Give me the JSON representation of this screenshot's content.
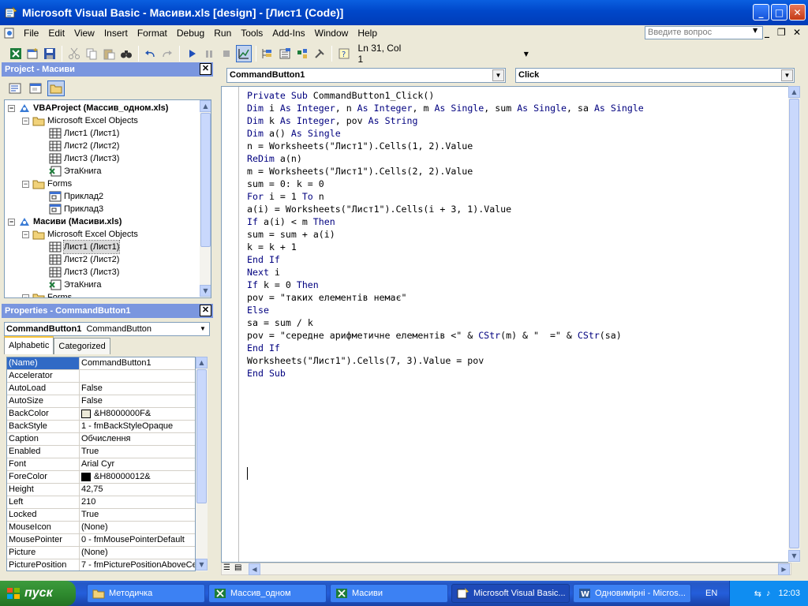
{
  "window": {
    "title": "Microsoft Visual Basic - Масиви.xls [design] - [Лист1 (Code)]",
    "minimize": "_",
    "maximize": "□",
    "close": "✕"
  },
  "menu": [
    "File",
    "Edit",
    "View",
    "Insert",
    "Format",
    "Debug",
    "Run",
    "Tools",
    "Add-Ins",
    "Window",
    "Help"
  ],
  "help_box": {
    "placeholder": "Введите вопрос"
  },
  "toolbar": {
    "position": "Ln 31, Col 1"
  },
  "project": {
    "title": "Project - Масиви",
    "nodes": [
      {
        "label": "VBAProject (Массив_одном.xls)",
        "bold": true
      },
      {
        "label": "Microsoft Excel Objects"
      },
      {
        "label": "Лист1 (Лист1)"
      },
      {
        "label": "Лист2 (Лист2)"
      },
      {
        "label": "Лист3 (Лист3)"
      },
      {
        "label": "ЭтаКнига"
      },
      {
        "label": "Forms"
      },
      {
        "label": "Приклад2"
      },
      {
        "label": "Приклад3"
      },
      {
        "label": "Масиви (Масиви.xls)",
        "bold": true
      },
      {
        "label": "Microsoft Excel Objects"
      },
      {
        "label": "Лист1 (Лист1)"
      },
      {
        "label": "Лист2 (Лист2)"
      },
      {
        "label": "Лист3 (Лист3)"
      },
      {
        "label": "ЭтаКнига"
      },
      {
        "label": "Forms"
      }
    ]
  },
  "properties": {
    "title": "Properties - CommandButton1",
    "object": "CommandButton1",
    "object_type": "CommandButton",
    "tabs": [
      "Alphabetic",
      "Categorized"
    ],
    "rows": [
      {
        "name": "(Name)",
        "value": "CommandButton1"
      },
      {
        "name": "Accelerator",
        "value": ""
      },
      {
        "name": "AutoLoad",
        "value": "False"
      },
      {
        "name": "AutoSize",
        "value": "False"
      },
      {
        "name": "BackColor",
        "value": "&H8000000F&",
        "swatch": "#ece9d8"
      },
      {
        "name": "BackStyle",
        "value": "1 - fmBackStyleOpaque"
      },
      {
        "name": "Caption",
        "value": "Обчислення"
      },
      {
        "name": "Enabled",
        "value": "True"
      },
      {
        "name": "Font",
        "value": "Arial Cyr"
      },
      {
        "name": "ForeColor",
        "value": "&H80000012&",
        "swatch": "#000000"
      },
      {
        "name": "Height",
        "value": "42,75"
      },
      {
        "name": "Left",
        "value": "210"
      },
      {
        "name": "Locked",
        "value": "True"
      },
      {
        "name": "MouseIcon",
        "value": "(None)"
      },
      {
        "name": "MousePointer",
        "value": "0 - fmMousePointerDefault"
      },
      {
        "name": "Picture",
        "value": "(None)"
      },
      {
        "name": "PicturePosition",
        "value": "7 - fmPicturePositionAboveCenter"
      }
    ]
  },
  "code": {
    "object_combo": "CommandButton1",
    "proc_combo": "Click",
    "lines": [
      "Private Sub CommandButton1_Click()",
      "Dim i As Integer, n As Integer, m As Single, sum As Single, sa As Single",
      "Dim k As Integer, pov As String",
      "Dim a() As Single",
      "n = Worksheets(\"Лист1\").Cells(1, 2).Value",
      "ReDim a(n)",
      "m = Worksheets(\"Лист1\").Cells(2, 2).Value",
      "sum = 0: k = 0",
      "For i = 1 To n",
      "a(i) = Worksheets(\"Лист1\").Cells(i + 3, 1).Value",
      "If a(i) < m Then",
      "sum = sum + a(i)",
      "k = k + 1",
      "End If",
      "Next i",
      "If k = 0 Then",
      "pov = \"таких елементів немає\"",
      "Else",
      "sa = sum / k",
      "pov = \"середне арифметичне елементів <\" & CStr(m) & \"  =\" & CStr(sa)",
      "End If",
      "Worksheets(\"Лист1\").Cells(7, 3).Value = pov",
      "End Sub"
    ]
  },
  "taskbar": {
    "start": "пуск",
    "tasks": [
      {
        "label": "Методичка",
        "icon": "folder-icon"
      },
      {
        "label": "Массив_одном",
        "icon": "excel-icon"
      },
      {
        "label": "Масиви",
        "icon": "excel-icon"
      },
      {
        "label": "Microsoft Visual Basic...",
        "icon": "vba-icon",
        "active": true
      },
      {
        "label": "Одновимірні - Micros...",
        "icon": "word-icon"
      }
    ],
    "lang": "EN",
    "clock": "12:03"
  },
  "colors": {
    "keyword": "#00007f",
    "title_bar": "#0047c9",
    "taskbar": "#245edb"
  }
}
